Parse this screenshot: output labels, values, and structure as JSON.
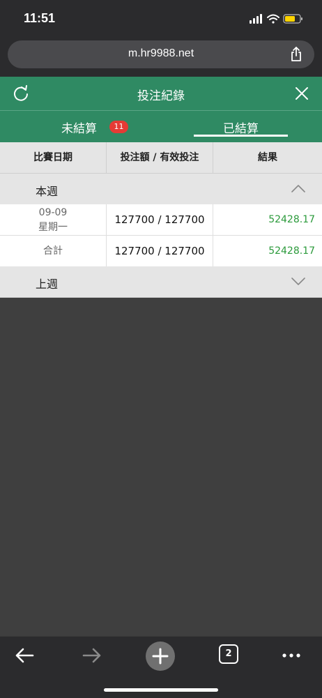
{
  "status": {
    "time": "11:51"
  },
  "browser": {
    "url": "m.hr9988.net",
    "tab_count": "2"
  },
  "header": {
    "title": "投注紀錄"
  },
  "tabs": [
    {
      "label": "未結算",
      "badge": "11"
    },
    {
      "label": "已結算"
    }
  ],
  "columns": [
    "比賽日期",
    "投注額 / 有效投注",
    "結果"
  ],
  "this_week": {
    "label": "本週",
    "rows": [
      {
        "date": "09-09",
        "weekday": "星期一",
        "bet": "127700 / 127700",
        "result": "52428.17"
      }
    ],
    "total": {
      "label": "合計",
      "bet": "127700 / 127700",
      "result": "52428.17"
    }
  },
  "last_week": {
    "label": "上週"
  },
  "colors": {
    "header_green": "#2f8a63",
    "result_green": "#2b9a3b",
    "badge_red": "#e53b35"
  }
}
